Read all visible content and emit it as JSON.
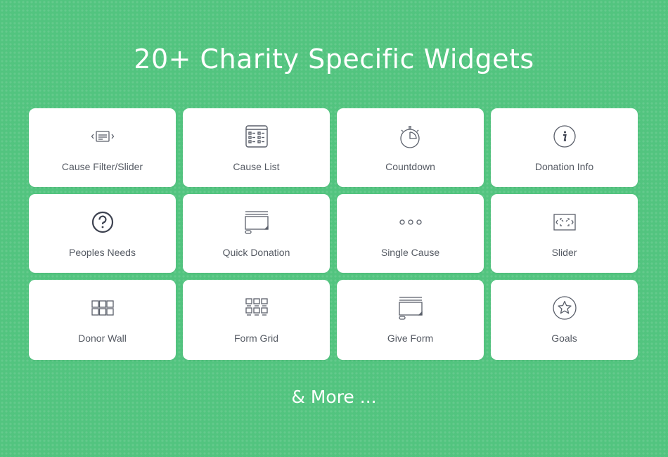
{
  "header": {
    "title": "20+ Charity Specific Widgets"
  },
  "widgets": [
    {
      "label": "Cause Filter/Slider",
      "icon": "carousel-icon"
    },
    {
      "label": "Cause List",
      "icon": "list-grid-icon"
    },
    {
      "label": "Countdown",
      "icon": "stopwatch-icon"
    },
    {
      "label": "Donation Info",
      "icon": "info-circle-icon"
    },
    {
      "label": "Peoples Needs",
      "icon": "question-circle-icon"
    },
    {
      "label": "Quick Donation",
      "icon": "form-window-icon"
    },
    {
      "label": "Single Cause",
      "icon": "three-dots-icon"
    },
    {
      "label": "Slider",
      "icon": "expand-slider-icon"
    },
    {
      "label": "Donor Wall",
      "icon": "grid-3x2-icon"
    },
    {
      "label": "Form Grid",
      "icon": "form-grid-icon"
    },
    {
      "label": "Give Form",
      "icon": "form-window-icon"
    },
    {
      "label": "Goals",
      "icon": "star-circle-icon"
    }
  ],
  "footer": {
    "more_label": "& More ..."
  },
  "colors": {
    "background": "#52c47f",
    "card": "#ffffff",
    "icon": "#5a5f6a",
    "label": "#555a63"
  }
}
